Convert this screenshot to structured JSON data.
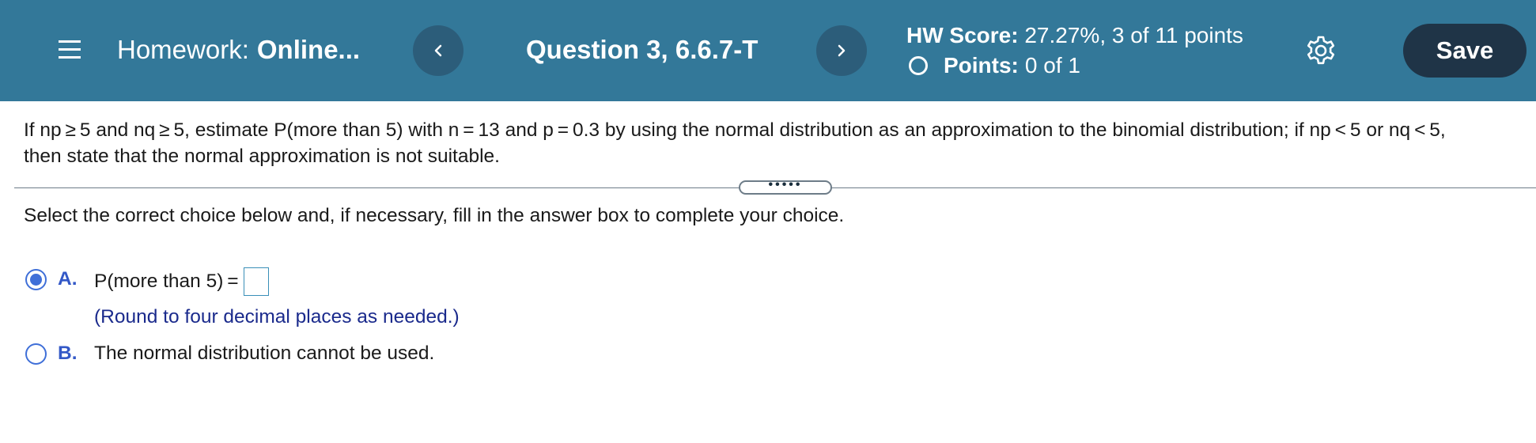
{
  "header": {
    "menu_icon": "hamburger-menu-icon",
    "homework_prefix": "Homework:",
    "homework_name": "Online...",
    "prev_icon": "chevron-left-icon",
    "question_title": "Question 3, 6.6.7-T",
    "next_icon": "chevron-right-icon",
    "hw_score_label": "HW Score:",
    "hw_score_value": "27.27%, 3 of 11 points",
    "points_label": "Points:",
    "points_value": "0 of 1",
    "settings_icon": "gear-icon",
    "save_label": "Save",
    "colors": {
      "bar": "#337899",
      "nav_button": "#2c5d7a",
      "save_button": "#1f3447"
    }
  },
  "question": {
    "line1": "If np ≥ 5 and nq ≥ 5, estimate P(more than 5) with n = 13 and p = 0.3 by using the normal distribution as an approximation to the binomial distribution; if np < 5 or nq < 5,",
    "line2": "then state that the normal approximation is not suitable.",
    "expand_dots": "•••••"
  },
  "instruction": "Select the correct choice below and, if necessary, fill in the answer box to complete your choice.",
  "choices": [
    {
      "letter": "A.",
      "text": "P(more than 5) =",
      "answer_value": "",
      "hint": "(Round to four decimal places as needed.)",
      "selected": true
    },
    {
      "letter": "B.",
      "text": "The normal distribution cannot be used.",
      "selected": false
    }
  ],
  "accent_color": "#3f6fd8"
}
